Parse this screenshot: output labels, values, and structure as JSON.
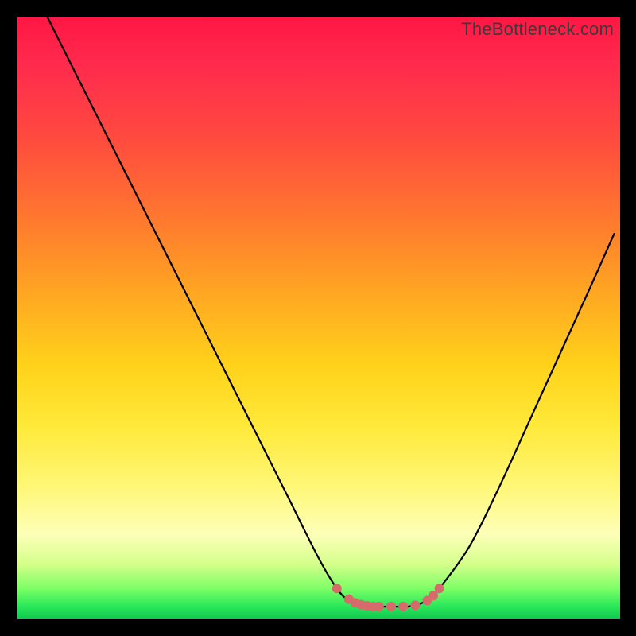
{
  "watermark": "TheBottleneck.com",
  "colors": {
    "frame": "#000000",
    "curve": "#000000",
    "marker": "#d76a6a",
    "gradient_stops": [
      "#ff1744",
      "#ff2b4d",
      "#ff4a3f",
      "#ff7a2e",
      "#ffa722",
      "#ffd21a",
      "#ffe93a",
      "#fff777",
      "#fdffb8",
      "#d4ff8a",
      "#7dff66",
      "#28e85a",
      "#12c94e"
    ]
  },
  "chart_data": {
    "type": "line",
    "title": "",
    "xlabel": "",
    "ylabel": "",
    "xlim": [
      0,
      100
    ],
    "ylim": [
      0,
      100
    ],
    "note": "x is normalized horizontal position; y is bottleneck mismatch percentage (0 at bottom, 100 at top). Curve estimated from gradient crossings.",
    "series": [
      {
        "name": "bottleneck-curve",
        "x": [
          5,
          10,
          15,
          20,
          25,
          30,
          35,
          40,
          45,
          50,
          53,
          55,
          58,
          62,
          65,
          68,
          70,
          75,
          80,
          85,
          90,
          95,
          99
        ],
        "y": [
          100,
          90,
          80,
          70,
          60,
          50,
          40,
          30,
          20,
          10,
          5,
          3,
          2,
          2,
          2,
          3,
          5,
          12,
          22,
          33,
          44,
          55,
          64
        ]
      }
    ],
    "markers": {
      "name": "highlighted-range",
      "x": [
        53,
        55,
        56,
        57,
        58,
        59,
        60,
        62,
        64,
        66,
        68,
        69,
        70
      ],
      "y": [
        5,
        3.2,
        2.6,
        2.3,
        2.1,
        2.0,
        2.0,
        2.0,
        2.0,
        2.2,
        3.0,
        3.8,
        5.0
      ]
    }
  }
}
